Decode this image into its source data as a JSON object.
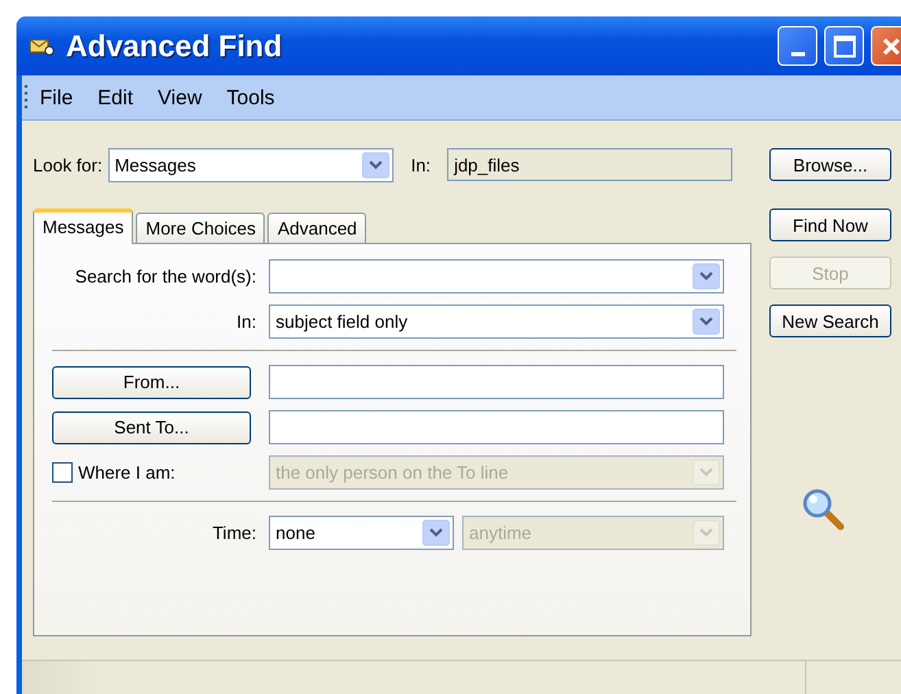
{
  "window": {
    "title": "Advanced Find"
  },
  "menu": [
    {
      "label": "File"
    },
    {
      "label": "Edit"
    },
    {
      "label": "View"
    },
    {
      "label": "Tools"
    }
  ],
  "look_for": {
    "label": "Look for:",
    "value": "Messages"
  },
  "in_folder": {
    "label": "In:",
    "value": "jdp_files"
  },
  "browse_button": {
    "label": "Browse..."
  },
  "tabs": [
    {
      "label": "Messages",
      "selected": true
    },
    {
      "label": "More Choices",
      "selected": false
    },
    {
      "label": "Advanced",
      "selected": false
    }
  ],
  "messages_tab": {
    "search_words": {
      "label": "Search for the word(s):",
      "disabled": false
    },
    "search_in": {
      "label": "In:",
      "value": "subject field only",
      "disabled": false
    },
    "from": {
      "label": "From..."
    },
    "sent_to": {
      "label": "Sent To..."
    },
    "where_i_am": {
      "label": "Where I am:",
      "checked": false,
      "value": "the only person on the To line",
      "disabled": true
    },
    "time": {
      "label": "Time:",
      "value": "none",
      "disabled": false,
      "range": {
        "value": "anytime",
        "disabled": true
      }
    }
  },
  "actions": [
    {
      "label": "Find Now",
      "disabled": false
    },
    {
      "label": "Stop",
      "disabled": true
    },
    {
      "label": "New Search",
      "disabled": false
    }
  ]
}
